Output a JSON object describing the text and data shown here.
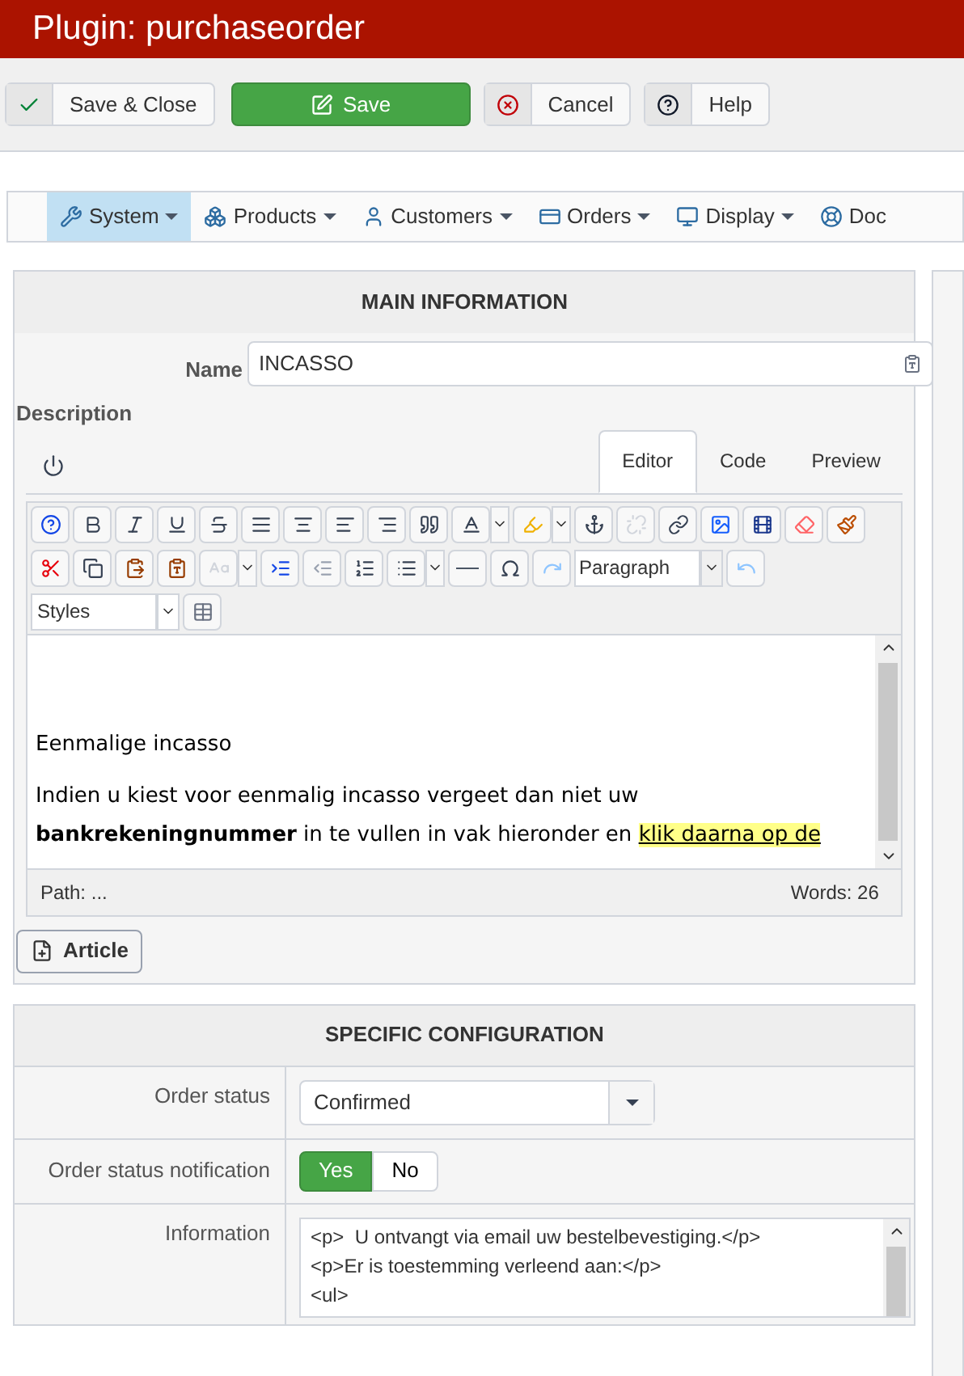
{
  "header": {
    "title": "Plugin: purchaseorder"
  },
  "toolbar": [
    {
      "kind": "check",
      "label": "Save & Close"
    },
    {
      "kind": "edit",
      "label": "Save"
    },
    {
      "kind": "cancel",
      "label": "Cancel"
    },
    {
      "kind": "help",
      "label": "Help"
    }
  ],
  "nav": [
    {
      "kind": "wrench",
      "label": "System",
      "selected": true
    },
    {
      "kind": "boxes",
      "label": "Products",
      "selected": false
    },
    {
      "kind": "user",
      "label": "Customers",
      "selected": false
    },
    {
      "kind": "card",
      "label": "Orders",
      "selected": false
    },
    {
      "kind": "monitor",
      "label": "Display",
      "selected": false
    },
    {
      "kind": "lifebuoy",
      "label": "Doc",
      "selected": false
    }
  ],
  "main_panel": {
    "title": "MAIN INFORMATION",
    "name_label": "Name",
    "name_value": "INCASSO",
    "description_label": "Description",
    "editor_tabs": [
      {
        "label": "Editor",
        "selected": true
      },
      {
        "label": "Code",
        "selected": false
      },
      {
        "label": "Preview",
        "selected": false
      }
    ],
    "format_select": "Paragraph",
    "styles_select": "Styles",
    "content_heading": "Eenmalige incasso",
    "content_text": "Indien u kiest voor eenmalig incasso vergeet dan niet uw **bankrekeningnummer** in te vullen in vak hieronder en",
    "content_link": "klik daarna op de",
    "path": "Path: ...",
    "words": "Words: 26",
    "article_button": "Article"
  },
  "config_panel": {
    "title": "SPECIFIC CONFIGURATION",
    "order_status_label": "Order status",
    "order_status_value": "Confirmed",
    "notification_label": "Order status notification",
    "notification_options": [
      {
        "label": "Yes",
        "selected": true
      },
      {
        "label": "No",
        "selected": false
      }
    ],
    "information_label": "Information",
    "information_lines": [
      "<p>  U ontvangt via email uw bestelbevestiging.</p>",
      "<p>Er is toestemming verleend aan:</p>",
      "<ul>"
    ]
  }
}
